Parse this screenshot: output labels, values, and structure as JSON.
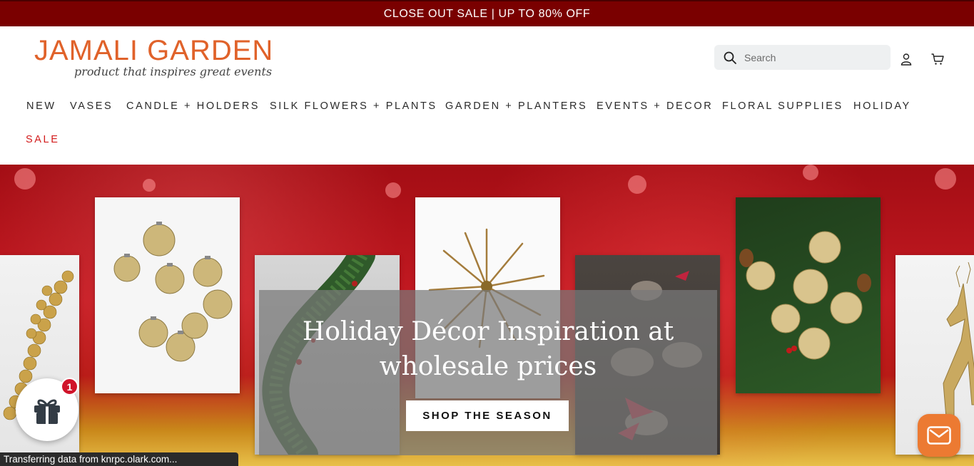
{
  "announcement": {
    "text": "CLOSE OUT SALE | UP TO 80% OFF"
  },
  "brand": {
    "name": "JAMALI GARDEN",
    "tagline": "product that inspires great events",
    "color": "#e0622a"
  },
  "search": {
    "placeholder": "Search"
  },
  "icons": {
    "search": "search-icon",
    "account": "user-icon",
    "cart": "cart-icon",
    "gift": "gift-icon",
    "chat": "envelope-icon"
  },
  "nav": {
    "items": [
      {
        "label": "NEW"
      },
      {
        "label": "VASES"
      },
      {
        "label": "CANDLE + HOLDERS"
      },
      {
        "label": "SILK FLOWERS + PLANTS"
      },
      {
        "label": "GARDEN + PLANTERS"
      },
      {
        "label": "EVENTS + DECOR"
      },
      {
        "label": "FLORAL SUPPLIES"
      },
      {
        "label": "HOLIDAY"
      },
      {
        "label": "SALE"
      }
    ]
  },
  "hero": {
    "title": "Holiday Décor Inspiration at wholesale prices",
    "button_label": "SHOP THE SEASON"
  },
  "gift_widget": {
    "badge_count": "1"
  },
  "status_bar": {
    "text": "Transferring data from knrpc.olark.com..."
  },
  "colors": {
    "announcement_bg": "#7a0000",
    "sale": "#d21b1b",
    "chat": "#ec7a32",
    "badge": "#d0142a"
  }
}
